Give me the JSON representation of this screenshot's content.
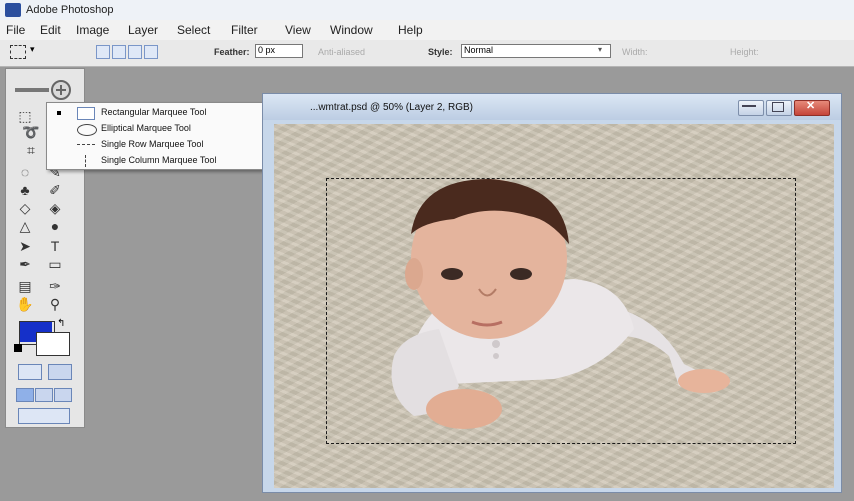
{
  "app": {
    "title": "Adobe Photoshop"
  },
  "menu": [
    "File",
    "Edit",
    "Image",
    "Layer",
    "Select",
    "Filter",
    "View",
    "Window",
    "Help"
  ],
  "options_bar": {
    "feather_label": "Feather:",
    "feather_value": "0 px",
    "antialiased_label": "Anti-aliased",
    "style_label": "Style:",
    "style_value": "Normal",
    "width_label": "Width:",
    "height_label": "Height:"
  },
  "tool_flyout": {
    "items": [
      {
        "label": "Rectangular Marquee Tool",
        "key": "M",
        "icon": "rectangle-marquee-icon",
        "selected": true
      },
      {
        "label": "Elliptical Marquee Tool",
        "key": "M",
        "icon": "ellipse-marquee-icon",
        "selected": false
      },
      {
        "label": "Single Row Marquee Tool",
        "key": "",
        "icon": "row-marquee-icon",
        "selected": false
      },
      {
        "label": "Single Column Marquee Tool",
        "key": "",
        "icon": "column-marquee-icon",
        "selected": false
      }
    ]
  },
  "document": {
    "title": "...wmtrat.psd @ 50% (Layer 2, RGB)"
  },
  "colors": {
    "foreground": "#1530c9",
    "background": "#ffffff",
    "title_blue": "#2b4f9e"
  }
}
